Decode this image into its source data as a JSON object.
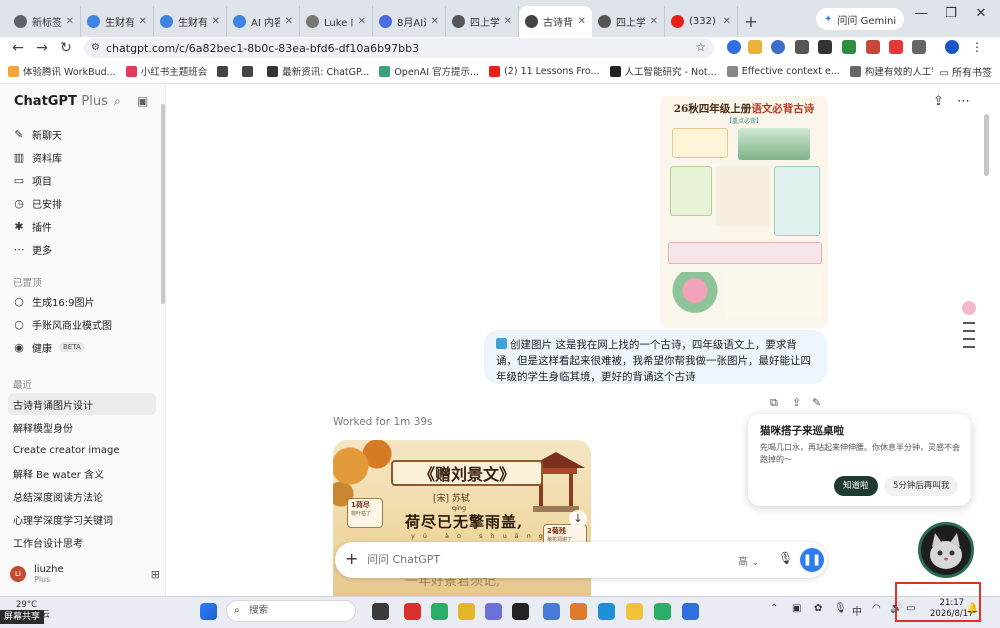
{
  "browser": {
    "tabs": [
      {
        "label": "新标签",
        "color": "#5f6368",
        "icon": "globe-icon"
      },
      {
        "label": "生财有",
        "color": "#3f83e4",
        "icon": "site-icon"
      },
      {
        "label": "生财有",
        "color": "#3f83e4",
        "icon": "site-icon"
      },
      {
        "label": "AI 内容",
        "color": "#3f83e4",
        "icon": "site-icon"
      },
      {
        "label": "Luke 内",
        "color": "#777777",
        "icon": "site-icon"
      },
      {
        "label": "8月AI选",
        "color": "#4a6ee0",
        "icon": "doc-icon"
      },
      {
        "label": "四上学",
        "color": "#555555",
        "icon": "doc-icon"
      },
      {
        "label": "古诗背",
        "color": "#444444",
        "icon": "openai-icon",
        "active": true
      },
      {
        "label": "四上学",
        "color": "#555555",
        "icon": "doc-icon"
      },
      {
        "label": "(332) Yo",
        "color": "#e62117",
        "icon": "youtube-icon"
      }
    ],
    "gemini_label": "问问 Gemini",
    "url": "chatgpt.com/c/6a82bec1-8b0c-83ea-bfd6-df10a6b97bb3",
    "bookmarks": [
      {
        "label": "体验腾讯 WorkBud...",
        "color": "#f2a33a"
      },
      {
        "label": "小红书主题班会",
        "color": "#e23a58"
      },
      {
        "label": "",
        "color": "#444444"
      },
      {
        "label": "",
        "color": "#444444"
      },
      {
        "label": "最新资讯: ChatGP...",
        "color": "#333333"
      },
      {
        "label": "OpenAI 官方提示...",
        "color": "#3aa27a"
      },
      {
        "label": "(2) 11 Lessons Fro...",
        "color": "#e62117"
      },
      {
        "label": "人工智能研究 - Not...",
        "color": "#222222"
      },
      {
        "label": "Effective context e...",
        "color": "#888888"
      },
      {
        "label": "构建有效的人工智...",
        "color": "#666666"
      }
    ],
    "all_bookmarks_label": "所有书签"
  },
  "sidebar": {
    "brand": "ChatGPT",
    "plan": "Plus",
    "nav": [
      {
        "label": "新聊天",
        "icon": "edit-icon"
      },
      {
        "label": "资料库",
        "icon": "library-icon"
      },
      {
        "label": "项目",
        "icon": "folder-icon"
      },
      {
        "label": "已安排",
        "icon": "clock-icon"
      },
      {
        "label": "插件",
        "icon": "plugin-icon"
      },
      {
        "label": "更多",
        "icon": "more-icon"
      }
    ],
    "pinned_header": "已置顶",
    "pinned": [
      {
        "label": "生成16:9图片"
      },
      {
        "label": "手账风商业模式图"
      },
      {
        "label": "健康",
        "badge": "BETA"
      }
    ],
    "recent_header": "最近",
    "recent": [
      {
        "label": "古诗背诵图片设计",
        "selected": true
      },
      {
        "label": "解释模型身份"
      },
      {
        "label": "Create creator image"
      },
      {
        "label": "解释 Be water 含义"
      },
      {
        "label": "总结深度阅读方法论"
      },
      {
        "label": "心理学深度学习关键词"
      },
      {
        "label": "工作台设计思考"
      }
    ],
    "user": {
      "initials": "LI",
      "name": "liuzhe",
      "plan": "Plus"
    }
  },
  "main": {
    "poster": {
      "title_pre": "26秋四年级上册",
      "title_hl": "语文必背古诗",
      "subtitle": "【重点必背】"
    },
    "user_message": "创建图片 这是我在网上找的一个古诗，四年级语文上，要求背诵，但是这样看起来很难被，我希望你帮我做一张图片，最好能让四年级的学生身临其境，更好的背诵这个古诗",
    "worked_label": "Worked for 1m 39s",
    "generated": {
      "title": "《赠刘景文》",
      "author": "[宋] 苏轼",
      "pinyin_top": "qíng",
      "line1": "荷尽已无擎雨盖,",
      "pinyin_line": "yǔ  ào  shuāng",
      "line2": "一年好景君须记,",
      "tag1_label": "1荷尽",
      "tag1_sub": "荷叶枯了",
      "tag2_label": "2菊残",
      "tag2_sub": "菊花凋谢了"
    },
    "composer": {
      "placeholder": "问问 ChatGPT",
      "model_label": "高 ⌄"
    }
  },
  "notification": {
    "title": "猫咪搭子来巡桌啦",
    "body": "先喝几口水，再站起来伸伸腰。你休息半分钟，灵感不会跑掉的～",
    "ok_label": "知道啦",
    "later_label": "5分钟后再叫我"
  },
  "taskbar": {
    "temperature": "29°C",
    "weather_text": "晴间多云",
    "screen_share_label": "屏幕共享",
    "search_placeholder": "搜索",
    "time": "21:17",
    "date": "2026/8/17",
    "ime_label": "中"
  }
}
